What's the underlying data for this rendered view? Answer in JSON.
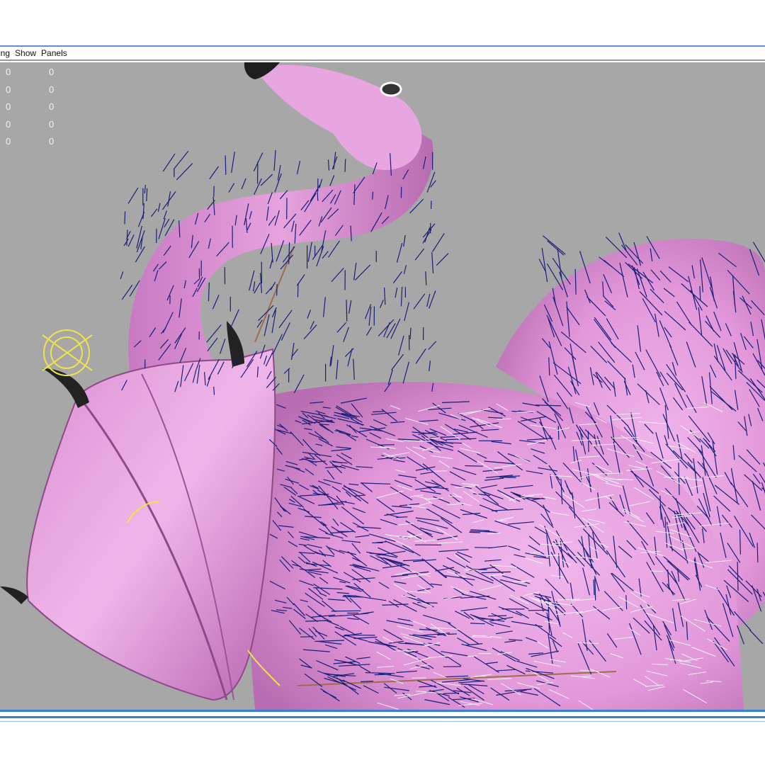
{
  "menubar": {
    "items": [
      {
        "label": "ing"
      },
      {
        "label": "Show"
      },
      {
        "label": "Panels"
      }
    ]
  },
  "viewport": {
    "background_color": "#a7a7a7",
    "hud_rows": [
      {
        "col1": "0",
        "col2": "0"
      },
      {
        "col1": "0",
        "col2": "0"
      },
      {
        "col1": "0",
        "col2": "0"
      },
      {
        "col1": "0",
        "col2": "0"
      },
      {
        "col1": "0",
        "col2": "0"
      }
    ],
    "subject": "pink-flamingo-model-with-fur-guides",
    "colors": {
      "body": "#e59fdd",
      "body_shade": "#c777c0",
      "fur": "#1a1f78",
      "fur_light": "#f2f2f2",
      "control": "#f0e44a",
      "beak": "#222222"
    }
  },
  "frame": {
    "accent": "#3a7fd6"
  }
}
